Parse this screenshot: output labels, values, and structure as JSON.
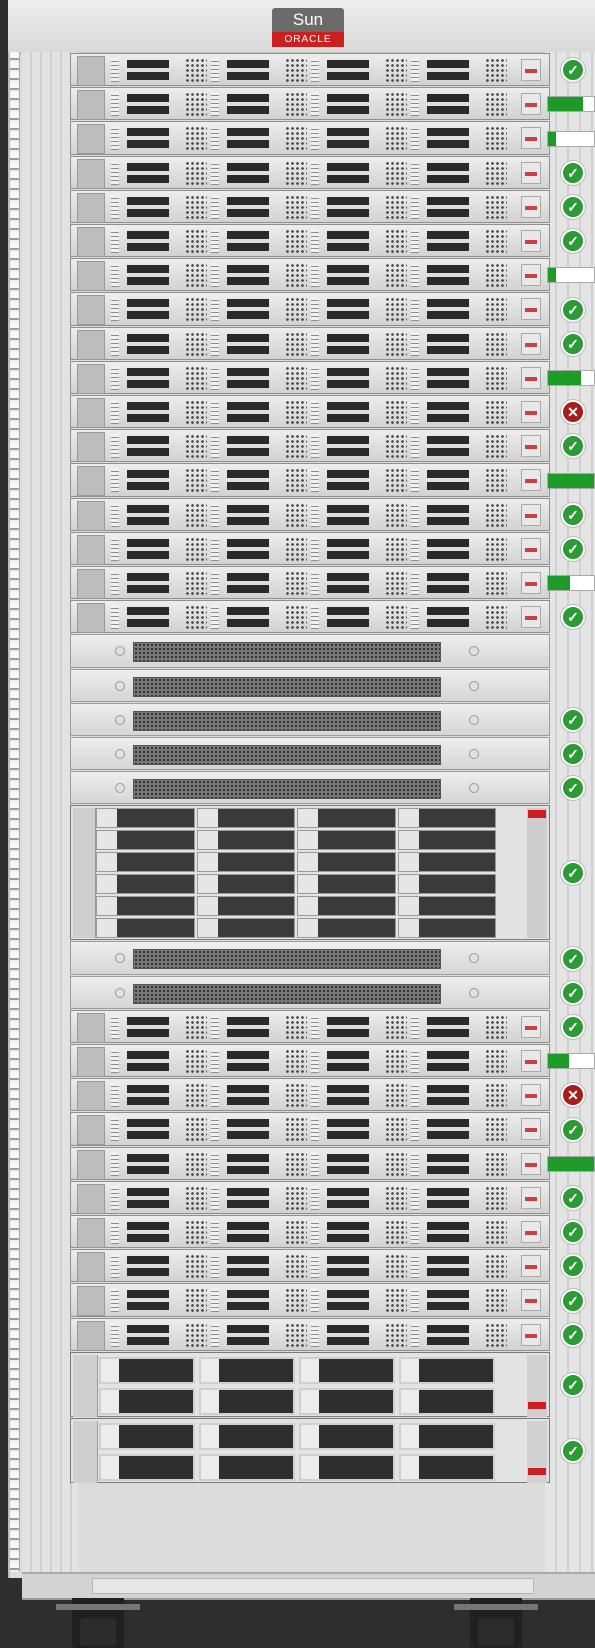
{
  "brand": {
    "top": "Sun",
    "bottom": "ORACLE"
  },
  "colors": {
    "ok": "#2c9a35",
    "error": "#a51d1d",
    "progress": "#1e9a28",
    "oracle_red": "#cc1f1f"
  },
  "icons": {
    "ok": "check-circle-icon",
    "error": "x-circle-icon"
  },
  "units": [
    {
      "type": "server",
      "status": "ok"
    },
    {
      "type": "server",
      "status": "progress",
      "progress": 0.75
    },
    {
      "type": "server",
      "status": "progress",
      "progress": 0.17
    },
    {
      "type": "server",
      "status": "ok"
    },
    {
      "type": "server",
      "status": "ok"
    },
    {
      "type": "server",
      "status": "ok"
    },
    {
      "type": "server",
      "status": "progress",
      "progress": 0.17
    },
    {
      "type": "server",
      "status": "ok"
    },
    {
      "type": "server",
      "status": "ok"
    },
    {
      "type": "server",
      "status": "progress",
      "progress": 0.72
    },
    {
      "type": "server",
      "status": "error"
    },
    {
      "type": "server",
      "status": "ok"
    },
    {
      "type": "server",
      "status": "progress",
      "progress": 1.0
    },
    {
      "type": "server",
      "status": "ok"
    },
    {
      "type": "server",
      "status": "ok"
    },
    {
      "type": "server",
      "status": "progress",
      "progress": 0.47
    },
    {
      "type": "server",
      "status": "ok"
    },
    {
      "type": "filler",
      "status": "none"
    },
    {
      "type": "filler",
      "status": "none"
    },
    {
      "type": "filler",
      "status": "ok"
    },
    {
      "type": "filler",
      "status": "ok"
    },
    {
      "type": "filler",
      "status": "ok"
    },
    {
      "type": "storage",
      "status": "ok"
    },
    {
      "type": "filler",
      "status": "ok"
    },
    {
      "type": "filler",
      "status": "ok"
    },
    {
      "type": "server",
      "status": "ok"
    },
    {
      "type": "server",
      "status": "progress",
      "progress": 0.45
    },
    {
      "type": "server",
      "status": "error"
    },
    {
      "type": "server",
      "status": "ok"
    },
    {
      "type": "server",
      "status": "progress",
      "progress": 1.0
    },
    {
      "type": "server",
      "status": "ok"
    },
    {
      "type": "server",
      "status": "ok"
    },
    {
      "type": "server",
      "status": "ok"
    },
    {
      "type": "server",
      "status": "ok"
    },
    {
      "type": "server",
      "status": "ok"
    },
    {
      "type": "jbod",
      "status": "ok"
    },
    {
      "type": "jbod",
      "status": "ok"
    }
  ]
}
